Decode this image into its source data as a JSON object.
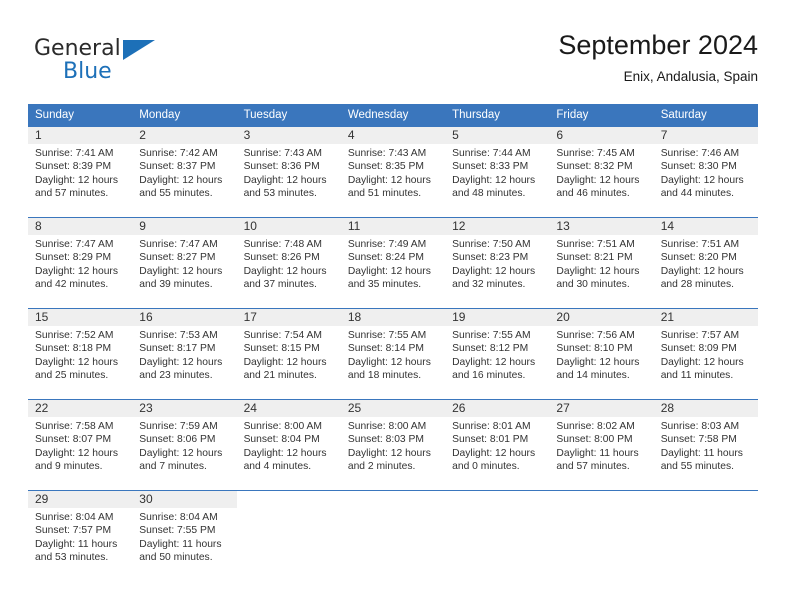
{
  "brand": {
    "name_part1": "General",
    "name_part2": "Blue",
    "triangle_color": "#1d70b8"
  },
  "header": {
    "title": "September 2024",
    "subtitle": "Enix, Andalusia, Spain"
  },
  "theme": {
    "header_blue": "#3a76bd",
    "daynum_band": "#efefef",
    "text": "#333333"
  },
  "weekday_headers": [
    "Sunday",
    "Monday",
    "Tuesday",
    "Wednesday",
    "Thursday",
    "Friday",
    "Saturday"
  ],
  "weeks": [
    [
      {
        "day": "1",
        "sunrise": "Sunrise: 7:41 AM",
        "sunset": "Sunset: 8:39 PM",
        "daylight_line1": "Daylight: 12 hours",
        "daylight_line2": "and 57 minutes."
      },
      {
        "day": "2",
        "sunrise": "Sunrise: 7:42 AM",
        "sunset": "Sunset: 8:37 PM",
        "daylight_line1": "Daylight: 12 hours",
        "daylight_line2": "and 55 minutes."
      },
      {
        "day": "3",
        "sunrise": "Sunrise: 7:43 AM",
        "sunset": "Sunset: 8:36 PM",
        "daylight_line1": "Daylight: 12 hours",
        "daylight_line2": "and 53 minutes."
      },
      {
        "day": "4",
        "sunrise": "Sunrise: 7:43 AM",
        "sunset": "Sunset: 8:35 PM",
        "daylight_line1": "Daylight: 12 hours",
        "daylight_line2": "and 51 minutes."
      },
      {
        "day": "5",
        "sunrise": "Sunrise: 7:44 AM",
        "sunset": "Sunset: 8:33 PM",
        "daylight_line1": "Daylight: 12 hours",
        "daylight_line2": "and 48 minutes."
      },
      {
        "day": "6",
        "sunrise": "Sunrise: 7:45 AM",
        "sunset": "Sunset: 8:32 PM",
        "daylight_line1": "Daylight: 12 hours",
        "daylight_line2": "and 46 minutes."
      },
      {
        "day": "7",
        "sunrise": "Sunrise: 7:46 AM",
        "sunset": "Sunset: 8:30 PM",
        "daylight_line1": "Daylight: 12 hours",
        "daylight_line2": "and 44 minutes."
      }
    ],
    [
      {
        "day": "8",
        "sunrise": "Sunrise: 7:47 AM",
        "sunset": "Sunset: 8:29 PM",
        "daylight_line1": "Daylight: 12 hours",
        "daylight_line2": "and 42 minutes."
      },
      {
        "day": "9",
        "sunrise": "Sunrise: 7:47 AM",
        "sunset": "Sunset: 8:27 PM",
        "daylight_line1": "Daylight: 12 hours",
        "daylight_line2": "and 39 minutes."
      },
      {
        "day": "10",
        "sunrise": "Sunrise: 7:48 AM",
        "sunset": "Sunset: 8:26 PM",
        "daylight_line1": "Daylight: 12 hours",
        "daylight_line2": "and 37 minutes."
      },
      {
        "day": "11",
        "sunrise": "Sunrise: 7:49 AM",
        "sunset": "Sunset: 8:24 PM",
        "daylight_line1": "Daylight: 12 hours",
        "daylight_line2": "and 35 minutes."
      },
      {
        "day": "12",
        "sunrise": "Sunrise: 7:50 AM",
        "sunset": "Sunset: 8:23 PM",
        "daylight_line1": "Daylight: 12 hours",
        "daylight_line2": "and 32 minutes."
      },
      {
        "day": "13",
        "sunrise": "Sunrise: 7:51 AM",
        "sunset": "Sunset: 8:21 PM",
        "daylight_line1": "Daylight: 12 hours",
        "daylight_line2": "and 30 minutes."
      },
      {
        "day": "14",
        "sunrise": "Sunrise: 7:51 AM",
        "sunset": "Sunset: 8:20 PM",
        "daylight_line1": "Daylight: 12 hours",
        "daylight_line2": "and 28 minutes."
      }
    ],
    [
      {
        "day": "15",
        "sunrise": "Sunrise: 7:52 AM",
        "sunset": "Sunset: 8:18 PM",
        "daylight_line1": "Daylight: 12 hours",
        "daylight_line2": "and 25 minutes."
      },
      {
        "day": "16",
        "sunrise": "Sunrise: 7:53 AM",
        "sunset": "Sunset: 8:17 PM",
        "daylight_line1": "Daylight: 12 hours",
        "daylight_line2": "and 23 minutes."
      },
      {
        "day": "17",
        "sunrise": "Sunrise: 7:54 AM",
        "sunset": "Sunset: 8:15 PM",
        "daylight_line1": "Daylight: 12 hours",
        "daylight_line2": "and 21 minutes."
      },
      {
        "day": "18",
        "sunrise": "Sunrise: 7:55 AM",
        "sunset": "Sunset: 8:14 PM",
        "daylight_line1": "Daylight: 12 hours",
        "daylight_line2": "and 18 minutes."
      },
      {
        "day": "19",
        "sunrise": "Sunrise: 7:55 AM",
        "sunset": "Sunset: 8:12 PM",
        "daylight_line1": "Daylight: 12 hours",
        "daylight_line2": "and 16 minutes."
      },
      {
        "day": "20",
        "sunrise": "Sunrise: 7:56 AM",
        "sunset": "Sunset: 8:10 PM",
        "daylight_line1": "Daylight: 12 hours",
        "daylight_line2": "and 14 minutes."
      },
      {
        "day": "21",
        "sunrise": "Sunrise: 7:57 AM",
        "sunset": "Sunset: 8:09 PM",
        "daylight_line1": "Daylight: 12 hours",
        "daylight_line2": "and 11 minutes."
      }
    ],
    [
      {
        "day": "22",
        "sunrise": "Sunrise: 7:58 AM",
        "sunset": "Sunset: 8:07 PM",
        "daylight_line1": "Daylight: 12 hours",
        "daylight_line2": "and 9 minutes."
      },
      {
        "day": "23",
        "sunrise": "Sunrise: 7:59 AM",
        "sunset": "Sunset: 8:06 PM",
        "daylight_line1": "Daylight: 12 hours",
        "daylight_line2": "and 7 minutes."
      },
      {
        "day": "24",
        "sunrise": "Sunrise: 8:00 AM",
        "sunset": "Sunset: 8:04 PM",
        "daylight_line1": "Daylight: 12 hours",
        "daylight_line2": "and 4 minutes."
      },
      {
        "day": "25",
        "sunrise": "Sunrise: 8:00 AM",
        "sunset": "Sunset: 8:03 PM",
        "daylight_line1": "Daylight: 12 hours",
        "daylight_line2": "and 2 minutes."
      },
      {
        "day": "26",
        "sunrise": "Sunrise: 8:01 AM",
        "sunset": "Sunset: 8:01 PM",
        "daylight_line1": "Daylight: 12 hours",
        "daylight_line2": "and 0 minutes."
      },
      {
        "day": "27",
        "sunrise": "Sunrise: 8:02 AM",
        "sunset": "Sunset: 8:00 PM",
        "daylight_line1": "Daylight: 11 hours",
        "daylight_line2": "and 57 minutes."
      },
      {
        "day": "28",
        "sunrise": "Sunrise: 8:03 AM",
        "sunset": "Sunset: 7:58 PM",
        "daylight_line1": "Daylight: 11 hours",
        "daylight_line2": "and 55 minutes."
      }
    ],
    [
      {
        "day": "29",
        "sunrise": "Sunrise: 8:04 AM",
        "sunset": "Sunset: 7:57 PM",
        "daylight_line1": "Daylight: 11 hours",
        "daylight_line2": "and 53 minutes."
      },
      {
        "day": "30",
        "sunrise": "Sunrise: 8:04 AM",
        "sunset": "Sunset: 7:55 PM",
        "daylight_line1": "Daylight: 11 hours",
        "daylight_line2": "and 50 minutes."
      },
      {
        "day": "",
        "sunrise": "",
        "sunset": "",
        "daylight_line1": "",
        "daylight_line2": ""
      },
      {
        "day": "",
        "sunrise": "",
        "sunset": "",
        "daylight_line1": "",
        "daylight_line2": ""
      },
      {
        "day": "",
        "sunrise": "",
        "sunset": "",
        "daylight_line1": "",
        "daylight_line2": ""
      },
      {
        "day": "",
        "sunrise": "",
        "sunset": "",
        "daylight_line1": "",
        "daylight_line2": ""
      },
      {
        "day": "",
        "sunrise": "",
        "sunset": "",
        "daylight_line1": "",
        "daylight_line2": ""
      }
    ]
  ]
}
